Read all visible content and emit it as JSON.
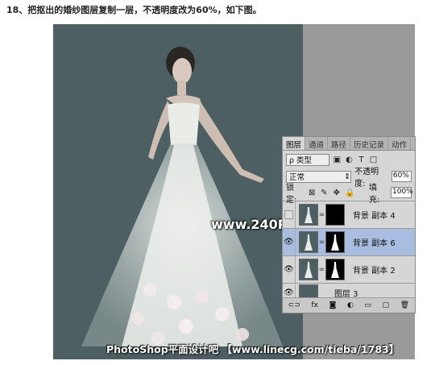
{
  "caption": "18、把抠出的婚纱图层复制一层，不透明度改为60%，如下图。",
  "watermark_main": "www.240PS.com",
  "watermark_footer": "PhotoShop平面设计吧 【www.linecg.com/tieba/1783】",
  "panel": {
    "tabs": [
      "图层",
      "通道",
      "路径",
      "历史记录",
      "动作"
    ],
    "kind_label": "ρ 类型",
    "blend_mode": "正常",
    "opacity_label": "不透明度:",
    "opacity_value": "60%",
    "lock_label": "锁定:",
    "fill_label": "填充:",
    "fill_value": "100%",
    "layers": [
      {
        "name": "背景 副本 4",
        "visible": false,
        "selected": false
      },
      {
        "name": "背景 副本 6",
        "visible": true,
        "selected": true
      },
      {
        "name": "背景 副本 2",
        "visible": true,
        "selected": false
      },
      {
        "name": "图层 3",
        "visible": true,
        "selected": false
      }
    ],
    "footer_icons": [
      "link-icon",
      "fx-icon",
      "mask-icon",
      "adjustment-icon",
      "group-icon",
      "new-layer-icon",
      "trash-icon"
    ]
  },
  "colors": {
    "canvas_bg": "#4d5f62",
    "selected_layer": "#a8bddf"
  }
}
